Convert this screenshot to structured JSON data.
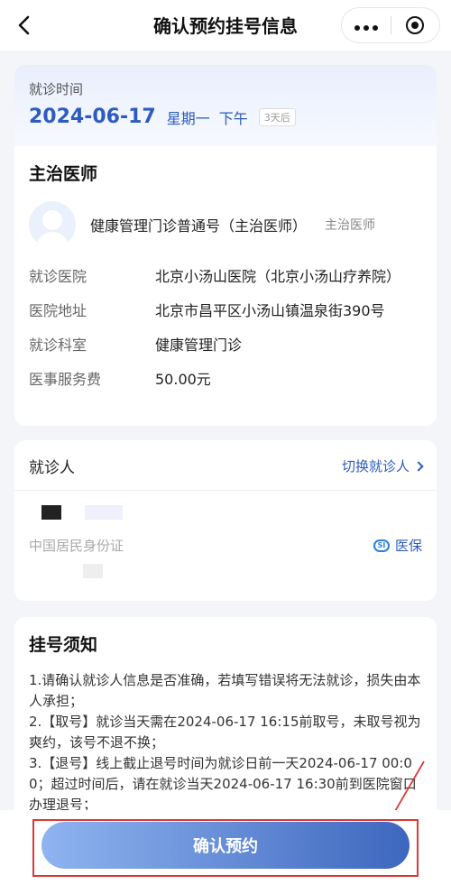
{
  "header": {
    "title": "确认预约挂号信息"
  },
  "visit_time": {
    "label": "就诊时间",
    "date": "2024-06-17",
    "weekday": "星期一",
    "period": "下午",
    "days_tag": "3天后"
  },
  "doctor": {
    "section_title": "主治医师",
    "name": "健康管理门诊普通号（主治医师）",
    "title": "主治医师"
  },
  "info": [
    {
      "key": "就诊医院",
      "value": "北京小汤山医院（北京小汤山疗养院）"
    },
    {
      "key": "医院地址",
      "value": "北京市昌平区小汤山镇温泉街390号"
    },
    {
      "key": "就诊科室",
      "value": "健康管理门诊"
    },
    {
      "key": "医事服务费",
      "value": "50.00元"
    }
  ],
  "patient": {
    "label": "就诊人",
    "switch_label": "切换就诊人",
    "id_type": "中国居民身份证",
    "insurance_label": "医保",
    "insurance_icon_text": "SI"
  },
  "notice": {
    "title": "挂号须知",
    "items": [
      "1.请确认就诊人信息是否准确，若填写错误将无法就诊，损失由本人承担；",
      "2.【取号】就诊当天需在2024-06-17 16:15前取号，未取号视为爽约，该号不退不换；",
      "3.【退号】线上截止退号时间为就诊日前一天2024-06-17 00:00；超过时间后，请在就诊当天2024-06-17 16:30前到医院窗口办理退号；"
    ]
  },
  "footer": {
    "confirm_label": "确认预约"
  },
  "colors": {
    "accent": "#2d5bbf",
    "annotation": "#d63a3a"
  }
}
